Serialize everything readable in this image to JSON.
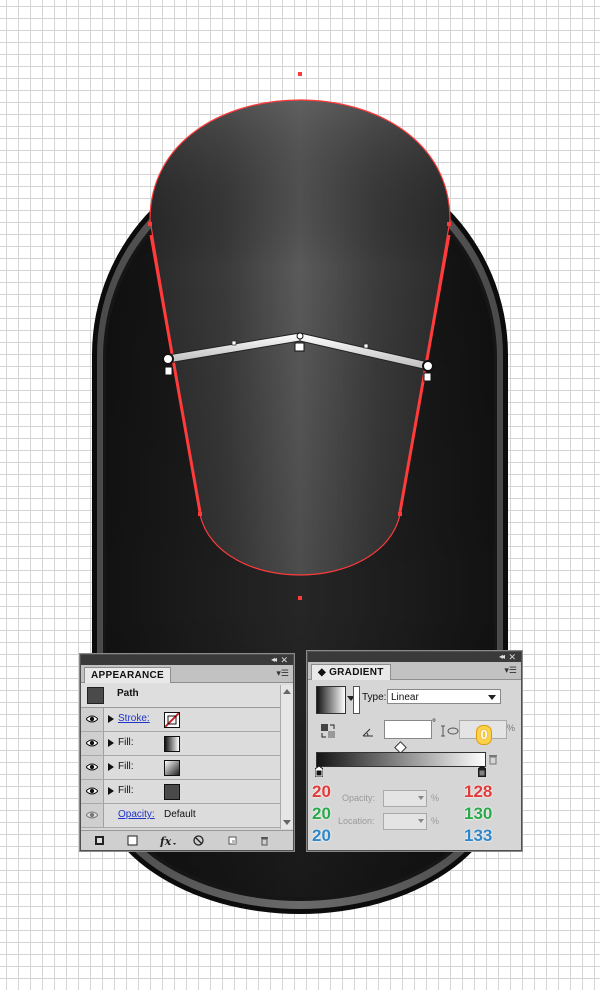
{
  "appearance_panel": {
    "tab": "APPEARANCE",
    "object_type": "Path",
    "rows": [
      {
        "label": "Stroke:",
        "kind": "stroke",
        "linked": true
      },
      {
        "label": "Fill:",
        "kind": "fill-gradient-a",
        "linked": false
      },
      {
        "label": "Fill:",
        "kind": "fill-gradient-b",
        "linked": false
      },
      {
        "label": "Fill:",
        "kind": "fill-solid",
        "linked": false
      }
    ],
    "opacity_label": "Opacity:",
    "opacity_value": "Default"
  },
  "gradient_panel": {
    "tab": "GRADIENT",
    "type_label": "Type:",
    "type_value": "Linear",
    "angle_symbol": "°",
    "aspect_badge": "0",
    "aspect_unit": "%",
    "opacity_label": "Opacity:",
    "location_label": "Location:",
    "percent": "%",
    "left_stop_rgb": [
      "20",
      "20",
      "20"
    ],
    "right_stop_rgb": [
      "128",
      "130",
      "133"
    ]
  },
  "colors": {
    "selection": "#ff3b3b",
    "stop_left": "#141414",
    "stop_right": "#808285"
  }
}
